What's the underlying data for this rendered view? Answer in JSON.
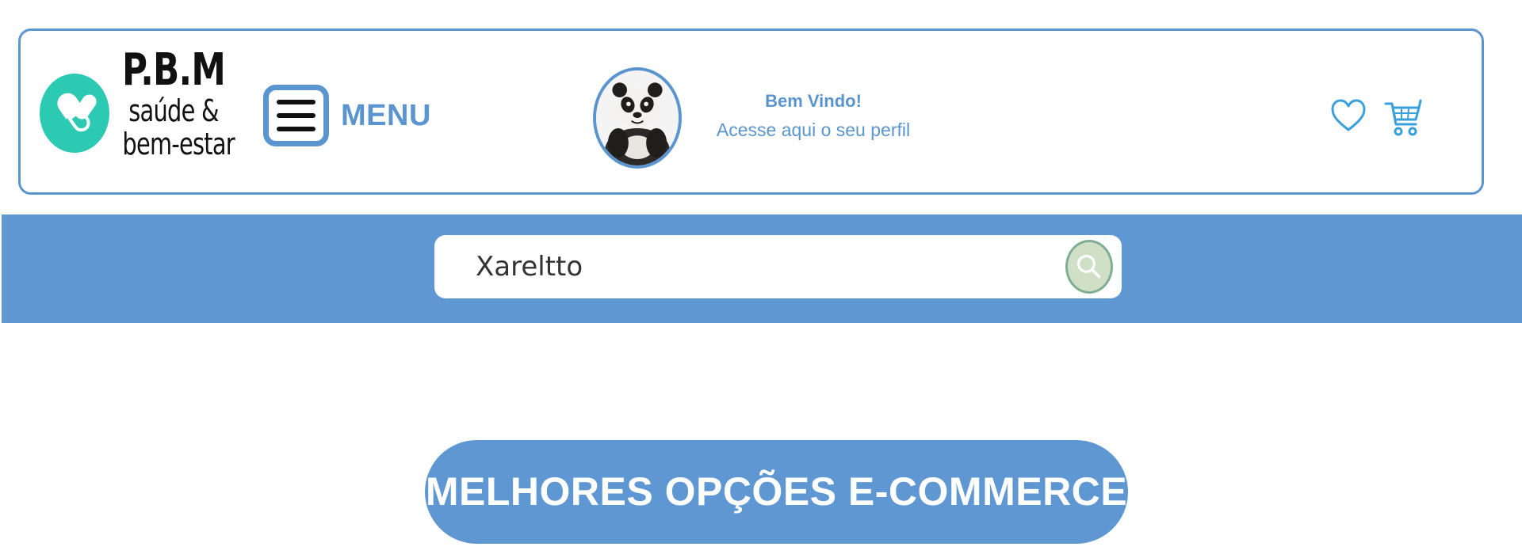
{
  "brand": {
    "title": "P.B.M",
    "subtitle_line1": "saúde &",
    "subtitle_line2": "bem-estar",
    "logo_icon": "pill-capsule-icon",
    "logo_color": "#2cc9b3"
  },
  "header": {
    "menu_label": "MENU",
    "welcome_title": "Bem Vindo!",
    "profile_link": "Acesse aqui o seu perfil",
    "avatar_icon": "panda-avatar",
    "icons": [
      "heart-icon",
      "cart-icon"
    ]
  },
  "search": {
    "value": "Xareltto",
    "button_icon": "search-icon"
  },
  "cta": {
    "label": "MELHORES OPÇÕES E-COMMERCE"
  },
  "colors": {
    "primary": "#5e97d1",
    "border": "#5b95d0",
    "logo": "#2cc9b3",
    "text_dark": "#111111",
    "background": "#ffffff"
  }
}
